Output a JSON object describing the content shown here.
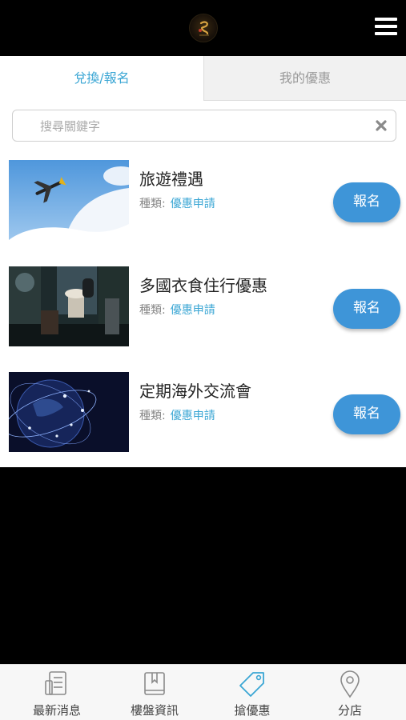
{
  "header": {
    "logo_icon": "brand-logo-icon",
    "menu_icon": "hamburger-menu-icon"
  },
  "tabs": [
    {
      "label": "兌換/報名",
      "active": true
    },
    {
      "label": "我的優惠",
      "active": false
    }
  ],
  "search": {
    "placeholder": "搜尋關鍵字",
    "value": "",
    "clear_icon": "clear-x-icon"
  },
  "items": [
    {
      "title": "旅遊禮遇",
      "meta_label": "種類:",
      "meta_value": "優惠申請",
      "button": "報名",
      "image": "airplane-sky-image"
    },
    {
      "title": "多國衣食住行優惠",
      "meta_label": "種類:",
      "meta_value": "優惠申請",
      "button": "報名",
      "image": "cafe-coffee-image"
    },
    {
      "title": "定期海外交流會",
      "meta_label": "種類:",
      "meta_value": "優惠申請",
      "button": "報名",
      "image": "globe-network-image"
    }
  ],
  "bottom_nav": [
    {
      "label": "最新消息",
      "icon": "news-icon"
    },
    {
      "label": "樓盤資訊",
      "icon": "book-icon"
    },
    {
      "label": "搶優惠",
      "icon": "tag-icon"
    },
    {
      "label": "分店",
      "icon": "location-pin-icon"
    }
  ],
  "colors": {
    "accent": "#3aa6d4",
    "button": "#3e95d8",
    "background_dark": "#000000"
  }
}
